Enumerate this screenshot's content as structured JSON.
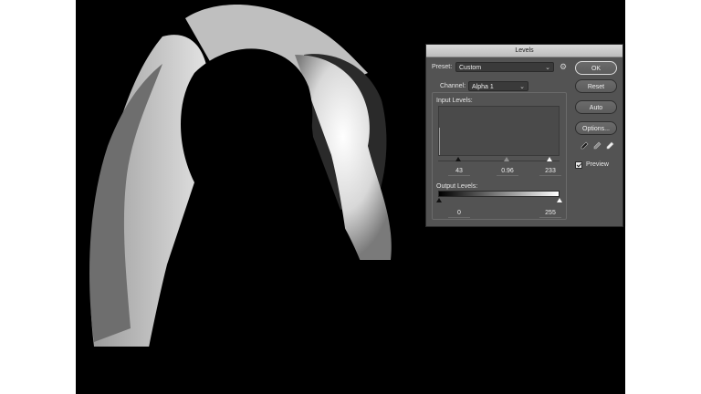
{
  "dialog": {
    "title": "Levels",
    "preset_label": "Preset:",
    "preset_value": "Custom",
    "channel_label": "Channel:",
    "channel_value": "Alpha 1",
    "input_levels_label": "Input Levels:",
    "input_black": "43",
    "input_gamma": "0.96",
    "input_white": "233",
    "output_levels_label": "Output Levels:",
    "output_black": "0",
    "output_white": "255",
    "preview_label": "Preview",
    "preview_checked": true
  },
  "buttons": {
    "ok": "OK",
    "reset": "Reset",
    "auto": "Auto",
    "options": "Options..."
  },
  "icons": {
    "preset_menu": "gear-icon",
    "eyedroppers": [
      "black-eyedropper-icon",
      "gray-eyedropper-icon",
      "white-eyedropper-icon"
    ]
  },
  "colors": {
    "dialog_bg": "#535353",
    "canvas_bg": "#000000"
  }
}
